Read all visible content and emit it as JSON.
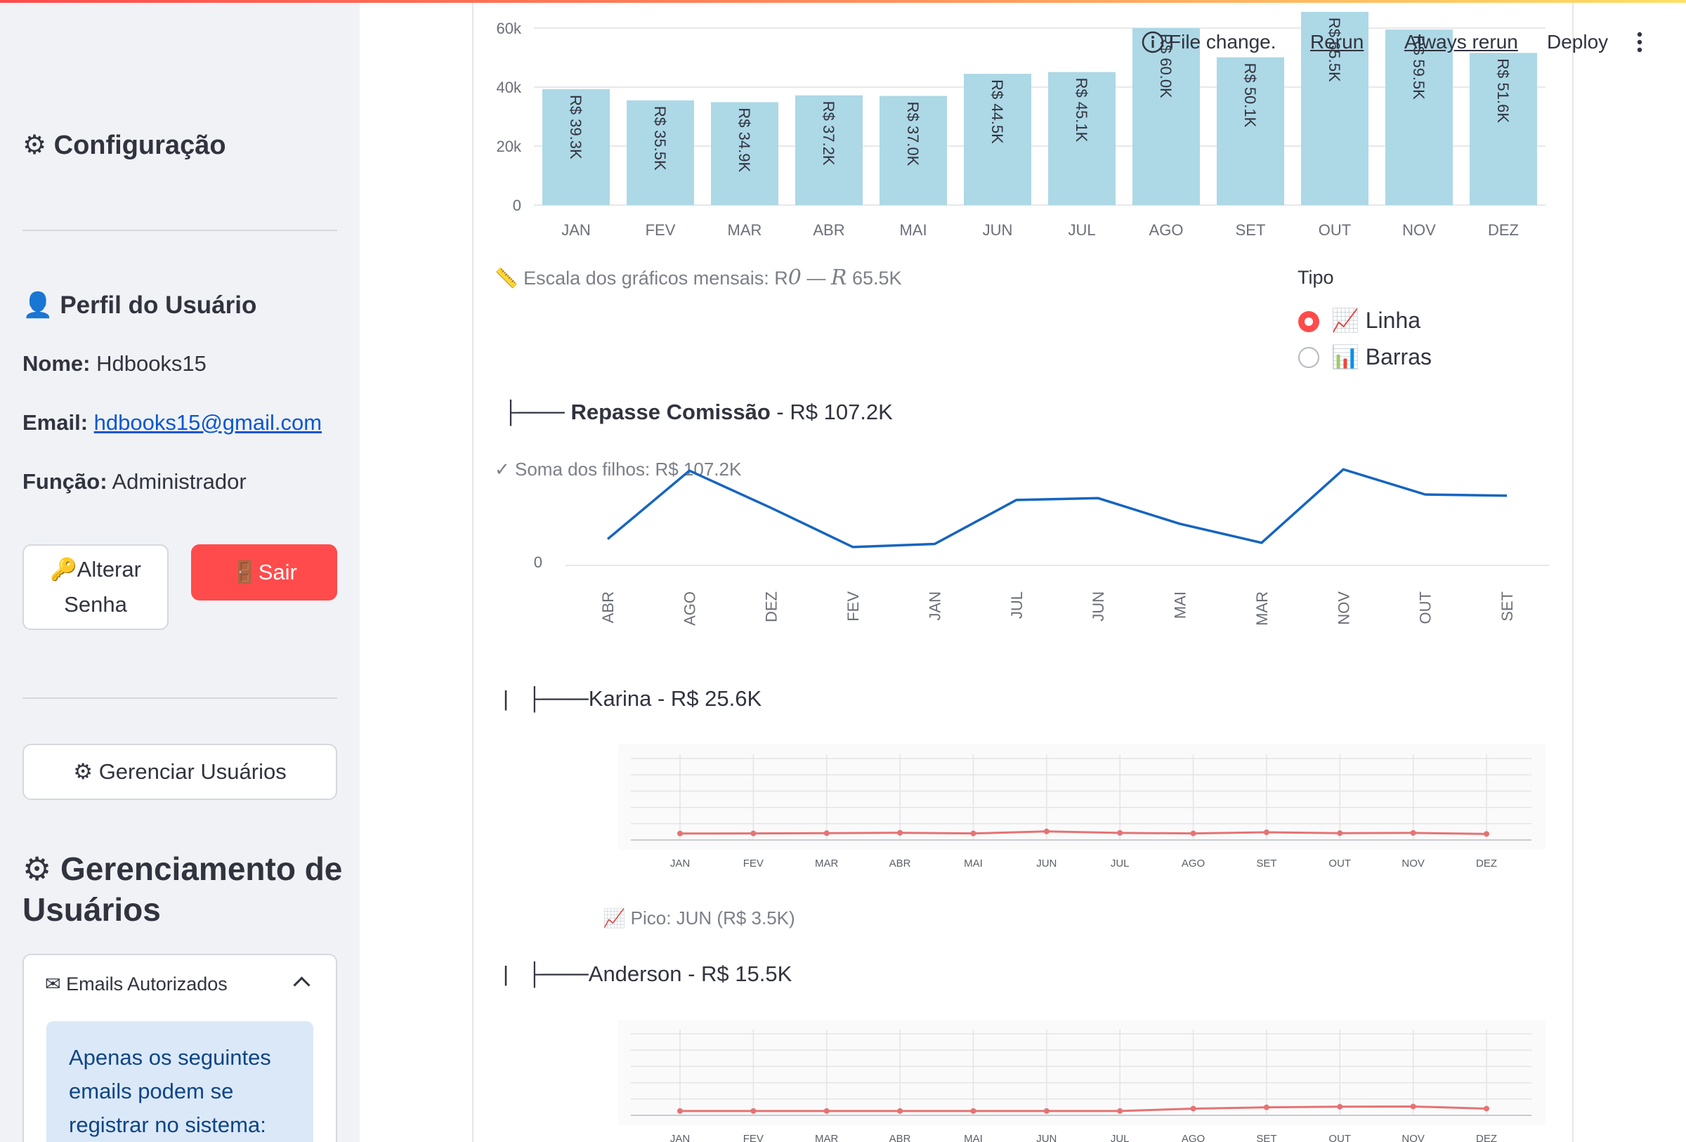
{
  "toolbar": {
    "status": "File change.",
    "rerun": "Rerun",
    "always_rerun": "Always rerun",
    "deploy": "Deploy"
  },
  "sidebar": {
    "config_title": "Configuração",
    "profile_title": "Perfil do Usuário",
    "name_label": "Nome:",
    "name_value": "Hdbooks15",
    "email_label": "Email:",
    "email_value": "hdbooks15@gmail.com",
    "role_label": "Função:",
    "role_value": "Administrador",
    "change_password_line1": "Alterar",
    "change_password_line2": "Senha",
    "logout": "Sair",
    "manage_users": "Gerenciar Usuários",
    "management_title_line1": "Gerenciamento de",
    "management_title_line2": "Usuários",
    "expander_title": "Emails Autorizados",
    "info_text": "Apenas os seguintes emails podem se registrar no sistema:"
  },
  "main": {
    "scale_note": "Escala dos gráficos mensais: R0 — R 65.5K",
    "scale_prefix": "Escala dos gráficos mensais: R",
    "scale_zero": "0",
    "scale_dash": " — ",
    "scale_r": "R",
    "scale_max": " 65.5K",
    "tipo_label": "Tipo",
    "tipo_options": [
      "Linha",
      "Barras"
    ],
    "tipo_selected": "Linha",
    "repasse_prefix": "├───",
    "repasse_title": "Repasse Comissão",
    "repasse_total": " - R$ 107.2K",
    "soma_filhos": "✓ Soma dos filhos: R$ 107.2K",
    "karina_title": "Karina - R$ 25.6K",
    "pico": "Pico: JUN (R$ 3.5K)",
    "anderson_title": "Anderson - R$ 15.5K",
    "tree_pipe": "|",
    "tree_branch": "├───"
  },
  "colors": {
    "accent": "#ff4b4b",
    "bar": "#add8e6",
    "line_blue": "#1565c0",
    "line_red": "#e57373",
    "sidebar_bg": "#f0f2f6"
  },
  "chart_data": [
    {
      "type": "bar",
      "categories": [
        "JAN",
        "FEV",
        "MAR",
        "ABR",
        "MAI",
        "JUN",
        "JUL",
        "AGO",
        "SET",
        "OUT",
        "NOV",
        "DEZ"
      ],
      "values": [
        39300,
        35500,
        34900,
        37200,
        37000,
        44500,
        45100,
        60000,
        50100,
        65500,
        59500,
        51600
      ],
      "data_labels": [
        "R$ 39.3K",
        "R$ 35.5K",
        "R$ 34.9K",
        "R$ 37.2K",
        "R$ 37.0K",
        "R$ 44.5K",
        "R$ 45.1K",
        "R$ 60.0K",
        "R$ 50.1K",
        "R$ 65.5K",
        "R$ 59.5K",
        "R$ 51.6K"
      ],
      "yticks": [
        "0",
        "20k",
        "40k",
        "60k"
      ],
      "ylim": [
        0,
        60000
      ],
      "grid": true
    },
    {
      "type": "line",
      "categories": [
        "ABR",
        "AGO",
        "DEZ",
        "FEV",
        "JAN",
        "JUL",
        "JUN",
        "MAI",
        "MAR",
        "NOV",
        "OUT",
        "SET"
      ],
      "values": [
        4300,
        15500,
        9400,
        3000,
        3500,
        10700,
        11000,
        6800,
        3700,
        15700,
        11600,
        11400
      ],
      "yticks": [
        "0"
      ],
      "grid": false
    },
    {
      "type": "line",
      "categories": [
        "JAN",
        "FEV",
        "MAR",
        "ABR",
        "MAI",
        "JUN",
        "JUL",
        "AGO",
        "SET",
        "OUT",
        "NOV",
        "DEZ"
      ],
      "values": [
        1800,
        1900,
        2100,
        2400,
        1900,
        3500,
        2300,
        1900,
        2800,
        2100,
        2300,
        1500
      ],
      "ylim": [
        0,
        65500
      ],
      "grid": true
    },
    {
      "type": "line",
      "categories": [
        "JAN",
        "FEV",
        "MAR",
        "ABR",
        "MAI",
        "JUN",
        "JUL",
        "AGO",
        "SET",
        "OUT",
        "NOV",
        "DEZ"
      ],
      "values": [
        100,
        100,
        100,
        100,
        100,
        100,
        100,
        2000,
        3000,
        3500,
        3700,
        2000
      ],
      "ylim": [
        0,
        65500
      ],
      "grid": true
    }
  ]
}
